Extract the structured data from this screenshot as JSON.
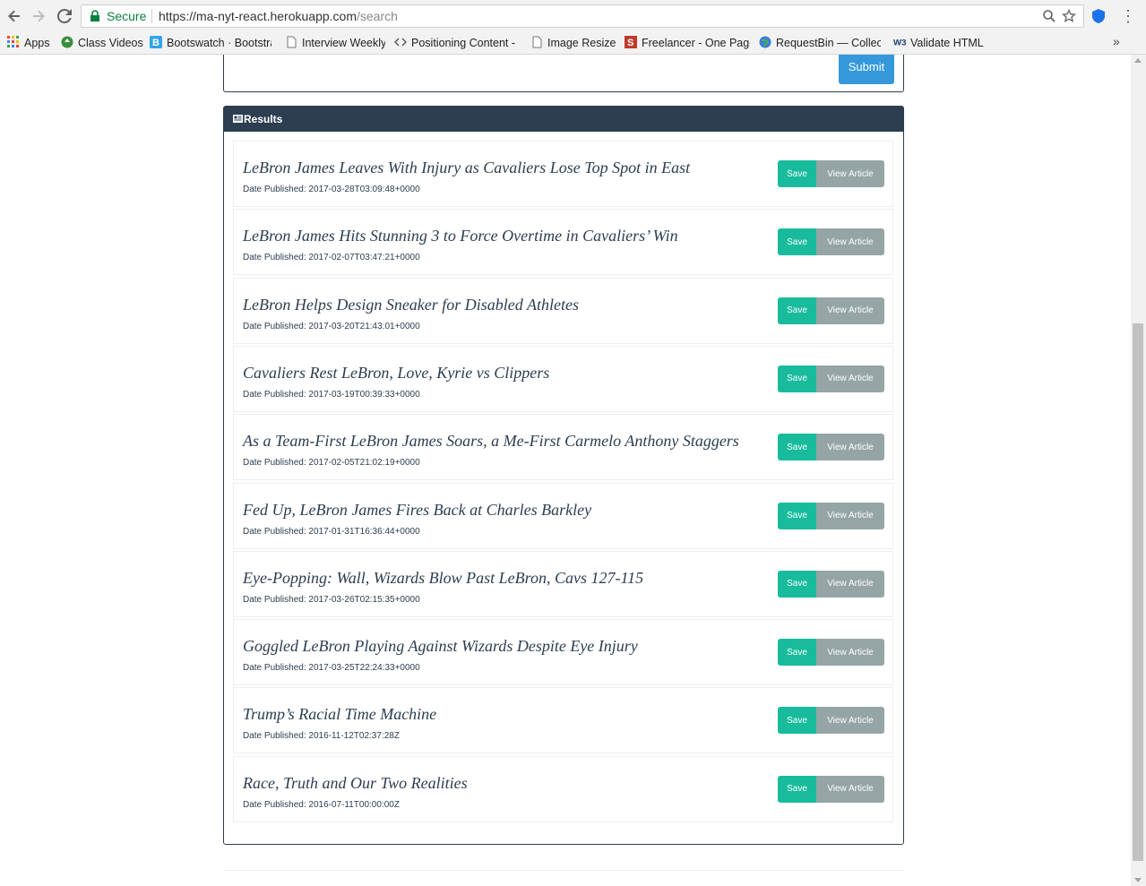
{
  "browser": {
    "secure_label": "Secure",
    "url_host": "https://ma-nyt-react.herokuapp.com",
    "url_path": "/search",
    "bookmarks": [
      {
        "label": "Apps"
      },
      {
        "label": "Class Videos"
      },
      {
        "label": "Bootswatch · Bootstra"
      },
      {
        "label": "Interview Weekly"
      },
      {
        "label": "Positioning Content -"
      },
      {
        "label": "Image Resizer"
      },
      {
        "label": "Freelancer - One Page"
      },
      {
        "label": "RequestBin — Collect"
      },
      {
        "label": "Validate HTML"
      }
    ],
    "more_label": "»"
  },
  "search": {
    "submit_label": "Submit"
  },
  "results": {
    "heading": "Results",
    "date_prefix": "Date Published:",
    "save_label": "Save",
    "view_label": "View Article",
    "articles": [
      {
        "title": "LeBron James Leaves With Injury as Cavaliers Lose Top Spot in East",
        "date": "2017-03-28T03:09:48+0000"
      },
      {
        "title": "LeBron James Hits Stunning 3 to Force Overtime in Cavaliers’ Win",
        "date": "2017-02-07T03:47:21+0000"
      },
      {
        "title": "LeBron Helps Design Sneaker for Disabled Athletes",
        "date": "2017-03-20T21:43:01+0000"
      },
      {
        "title": "Cavaliers Rest LeBron, Love, Kyrie vs Clippers",
        "date": "2017-03-19T00:39:33+0000"
      },
      {
        "title": "As a Team-First LeBron James Soars, a Me-First Carmelo Anthony Staggers",
        "date": "2017-02-05T21:02:19+0000"
      },
      {
        "title": "Fed Up, LeBron James Fires Back at Charles Barkley",
        "date": "2017-01-31T16:36:44+0000"
      },
      {
        "title": "Eye-Popping: Wall, Wizards Blow Past LeBron, Cavs 127-115",
        "date": "2017-03-26T02:15:35+0000"
      },
      {
        "title": "Goggled LeBron Playing Against Wizards Despite Eye Injury",
        "date": "2017-03-25T22:24:33+0000"
      },
      {
        "title": "Trump’s Racial Time Machine",
        "date": "2016-11-12T02:37:28Z"
      },
      {
        "title": "Race, Truth and Our Two Realities",
        "date": "2016-07-11T00:00:00Z"
      }
    ]
  },
  "colors": {
    "navbar": "#2c3e50",
    "save": "#18bc9c",
    "view": "#95a5a6",
    "submit": "#3498db"
  }
}
